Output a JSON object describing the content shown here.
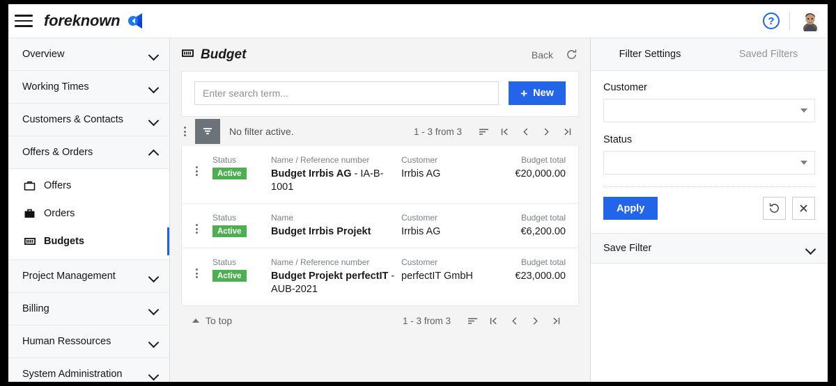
{
  "topbar": {
    "menu_icon": "hamburger-menu-icon",
    "brand": "foreknown",
    "logo_icon": "foreknown-logo-icon",
    "help_label": "?",
    "help_icon": "help-circle-icon",
    "avatar_icon": "user-avatar"
  },
  "sidebar": {
    "groups": [
      {
        "label": "Overview",
        "expanded": false
      },
      {
        "label": "Working Times",
        "expanded": false
      },
      {
        "label": "Customers & Contacts",
        "expanded": false
      },
      {
        "label": "Offers & Orders",
        "expanded": true
      },
      {
        "label": "Project Management",
        "expanded": false
      },
      {
        "label": "Billing",
        "expanded": false
      },
      {
        "label": "Human Ressources",
        "expanded": false
      },
      {
        "label": "System Administration",
        "expanded": false
      }
    ],
    "sub_items": [
      {
        "label": "Offers",
        "icon": "briefcase-outline-icon",
        "active": false
      },
      {
        "label": "Orders",
        "icon": "briefcase-filled-icon",
        "active": false
      },
      {
        "label": "Budgets",
        "icon": "money-bill-icon",
        "active": true
      }
    ]
  },
  "main": {
    "title": "Budget",
    "title_icon": "money-bill-icon",
    "back_label": "Back",
    "refresh_icon": "refresh-icon",
    "search": {
      "value": "",
      "placeholder": "Enter search term..."
    },
    "new_button": {
      "label": "New",
      "plus": "+"
    },
    "toolbar": {
      "kebab_icon": "more-vertical-icon",
      "filter_icon": "filter-funnel-icon",
      "filter_status": "No filter active.",
      "page_count": "1 - 3 from 3",
      "sort_icon": "sort-icon",
      "first_icon": "first-page-icon",
      "prev_icon": "prev-page-icon",
      "next_icon": "next-page-icon",
      "last_icon": "last-page-icon"
    },
    "columns": {
      "status": "Status",
      "name_ref": "Name / Reference number",
      "name": "Name",
      "customer": "Customer",
      "budget_total": "Budget total"
    },
    "rows": [
      {
        "status": "Active",
        "name_header": "Name / Reference number",
        "name": "Budget Irrbis AG",
        "reference": " - IA-B-1001",
        "customer": "Irrbis AG",
        "budget_total": "€20,000.00"
      },
      {
        "status": "Active",
        "name_header": "Name",
        "name": "Budget Irrbis Projekt",
        "reference": "",
        "customer": "Irrbis AG",
        "budget_total": "€6,200.00"
      },
      {
        "status": "Active",
        "name_header": "Name / Reference number",
        "name": "Budget Projekt perfectIT",
        "reference": " - AUB-2021",
        "customer": "perfectIT GmbH",
        "budget_total": "€23,000.00"
      }
    ],
    "footer": {
      "to_top": "To top",
      "page_count": "1 - 3 from 3"
    }
  },
  "right_panel": {
    "tabs": [
      {
        "label": "Filter Settings",
        "active": true
      },
      {
        "label": "Saved Filters",
        "active": false
      }
    ],
    "fields": [
      {
        "label": "Customer",
        "value": "",
        "icon": "chevron-down-icon"
      },
      {
        "label": "Status",
        "value": "",
        "icon": "chevron-down-icon"
      }
    ],
    "apply_label": "Apply",
    "reset_icon": "reset-icon",
    "clear_icon": "close-x-icon",
    "save_filter_label": "Save Filter"
  },
  "colors": {
    "accent_blue": "#2265e8",
    "logo_blue": "#1565f0",
    "status_green": "#4caf50",
    "filter_gray": "#6b7278",
    "page_bg": "#f4f4f4",
    "panel_bg": "#f7f8f9"
  }
}
